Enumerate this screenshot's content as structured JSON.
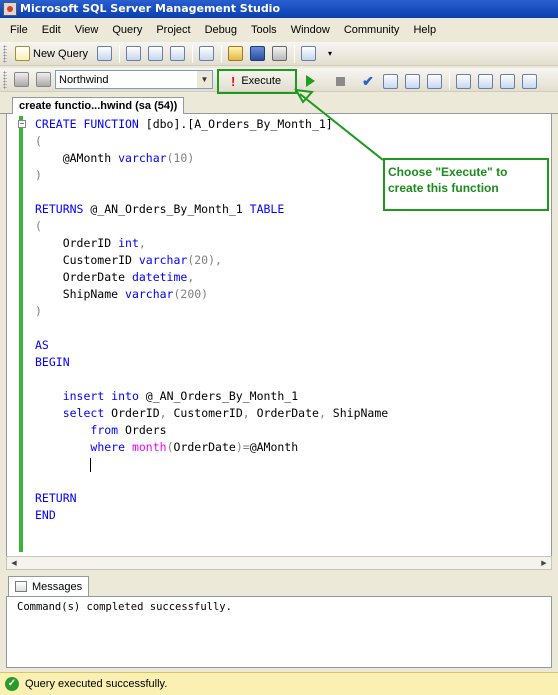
{
  "window": {
    "title": "Microsoft SQL Server Management Studio"
  },
  "menu": [
    "File",
    "Edit",
    "View",
    "Query",
    "Project",
    "Debug",
    "Tools",
    "Window",
    "Community",
    "Help"
  ],
  "toolbar1": {
    "new_query_label": "New Query"
  },
  "toolbar2": {
    "database": "Northwind",
    "execute_label": "Execute"
  },
  "document_tab": {
    "label": "create functio...hwind (sa (54))"
  },
  "code_lines": [
    [
      {
        "t": "CREATE FUNCTION",
        "c": "kw"
      },
      {
        "t": " [dbo].[A_Orders_By_Month_1]",
        "c": ""
      }
    ],
    [
      {
        "t": "(",
        "c": "gr"
      }
    ],
    [
      {
        "t": "    @AMonth ",
        "c": ""
      },
      {
        "t": "varchar",
        "c": "kw"
      },
      {
        "t": "(10)",
        "c": "gr"
      }
    ],
    [
      {
        "t": ")",
        "c": "gr"
      }
    ],
    [],
    [
      {
        "t": "RETURNS",
        "c": "kw"
      },
      {
        "t": " @_AN_Orders_By_Month_1 ",
        "c": ""
      },
      {
        "t": "TABLE",
        "c": "kw"
      }
    ],
    [
      {
        "t": "(",
        "c": "gr"
      }
    ],
    [
      {
        "t": "    OrderID ",
        "c": ""
      },
      {
        "t": "int",
        "c": "kw"
      },
      {
        "t": ",",
        "c": "gr"
      }
    ],
    [
      {
        "t": "    CustomerID ",
        "c": ""
      },
      {
        "t": "varchar",
        "c": "kw"
      },
      {
        "t": "(20),",
        "c": "gr"
      }
    ],
    [
      {
        "t": "    OrderDate ",
        "c": ""
      },
      {
        "t": "datetime",
        "c": "kw"
      },
      {
        "t": ",",
        "c": "gr"
      }
    ],
    [
      {
        "t": "    ShipName ",
        "c": ""
      },
      {
        "t": "varchar",
        "c": "kw"
      },
      {
        "t": "(200)",
        "c": "gr"
      }
    ],
    [
      {
        "t": ")",
        "c": "gr"
      }
    ],
    [],
    [
      {
        "t": "AS",
        "c": "kw"
      }
    ],
    [
      {
        "t": "BEGIN",
        "c": "kw"
      }
    ],
    [],
    [
      {
        "t": "    ",
        "c": ""
      },
      {
        "t": "insert into",
        "c": "kw"
      },
      {
        "t": " @_AN_Orders_By_Month_1",
        "c": ""
      }
    ],
    [
      {
        "t": "    ",
        "c": ""
      },
      {
        "t": "select",
        "c": "kw"
      },
      {
        "t": " OrderID",
        "c": ""
      },
      {
        "t": ",",
        "c": "gr"
      },
      {
        "t": " CustomerID",
        "c": ""
      },
      {
        "t": ",",
        "c": "gr"
      },
      {
        "t": " OrderDate",
        "c": ""
      },
      {
        "t": ",",
        "c": "gr"
      },
      {
        "t": " ShipName",
        "c": ""
      }
    ],
    [
      {
        "t": "        ",
        "c": ""
      },
      {
        "t": "from",
        "c": "kw"
      },
      {
        "t": " Orders",
        "c": ""
      }
    ],
    [
      {
        "t": "        ",
        "c": ""
      },
      {
        "t": "where",
        "c": "kw"
      },
      {
        "t": " ",
        "c": ""
      },
      {
        "t": "month",
        "c": "fn"
      },
      {
        "t": "(",
        "c": "gr"
      },
      {
        "t": "OrderDate",
        "c": ""
      },
      {
        "t": ")=",
        "c": "gr"
      },
      {
        "t": "@AMonth",
        "c": ""
      }
    ],
    [
      {
        "t": "        ",
        "c": ""
      },
      {
        "t": "",
        "c": "caret"
      }
    ],
    [],
    [
      {
        "t": "RETURN",
        "c": "kw"
      }
    ],
    [
      {
        "t": "END",
        "c": "kw"
      }
    ]
  ],
  "callout": {
    "text": "Choose \"Execute\" to create this function"
  },
  "results": {
    "tab_label": "Messages",
    "message": "Command(s) completed successfully."
  },
  "status": {
    "text": "Query executed successfully."
  },
  "colors": {
    "keyword": "#0000ff",
    "function": "#ff00ff",
    "operator": "#808080",
    "callout": "#1d9a1d",
    "status_bg": "#fbf0b4"
  }
}
